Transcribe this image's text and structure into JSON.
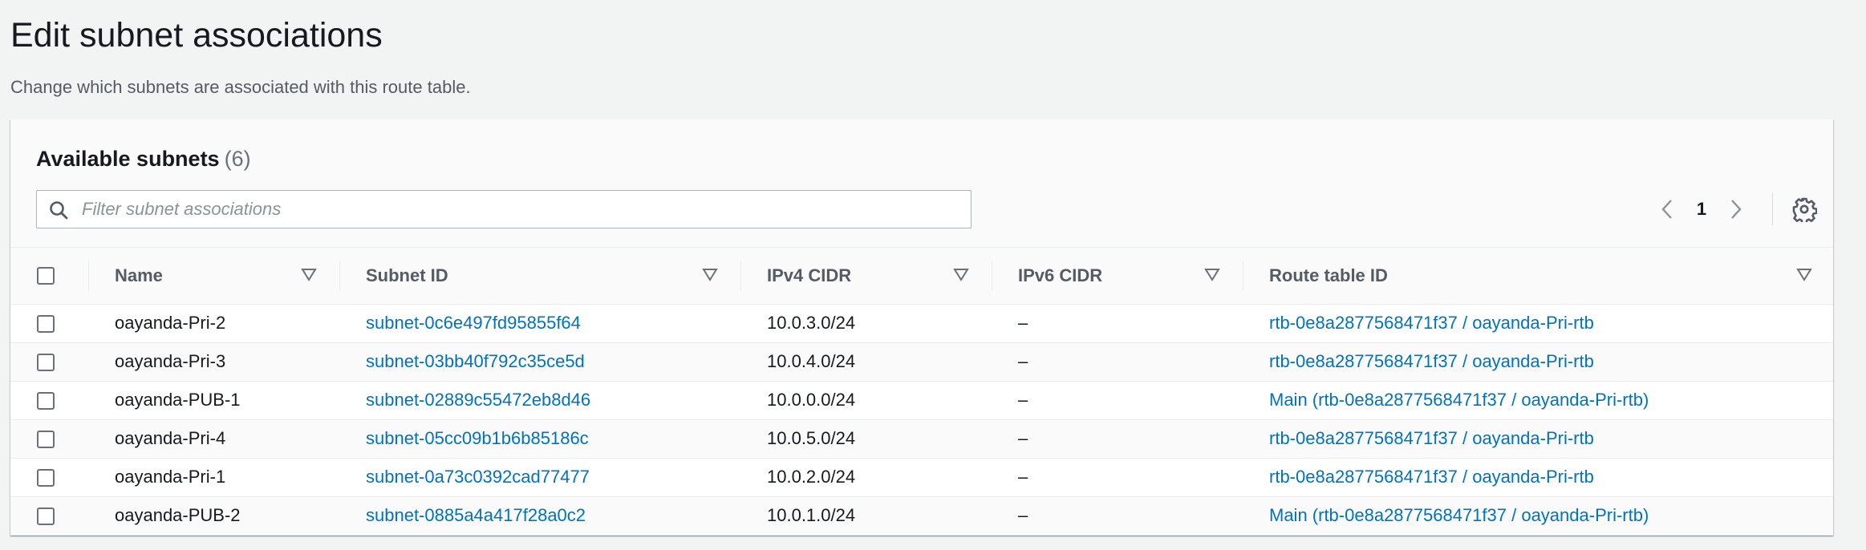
{
  "page": {
    "title": "Edit subnet associations",
    "description": "Change which subnets are associated with this route table."
  },
  "panel": {
    "title": "Available subnets",
    "count": "(6)"
  },
  "filter": {
    "placeholder": "Filter subnet associations",
    "value": ""
  },
  "pagination": {
    "current_page": "1"
  },
  "icons": {
    "search": "search-icon",
    "prev": "chevron-left-icon",
    "next": "chevron-right-icon",
    "settings": "gear-icon",
    "sort": "sort-triangle-icon"
  },
  "colors": {
    "link": "#0073bb",
    "header_text": "#545b64",
    "background": "#f2f3f3"
  },
  "table": {
    "columns": [
      "Name",
      "Subnet ID",
      "IPv4 CIDR",
      "IPv6 CIDR",
      "Route table ID"
    ],
    "rows": [
      {
        "name": "oayanda-Pri-2",
        "subnet_id": "subnet-0c6e497fd95855f64",
        "ipv4": "10.0.3.0/24",
        "ipv6": "–",
        "route_table": "rtb-0e8a2877568471f37 / oayanda-Pri-rtb"
      },
      {
        "name": "oayanda-Pri-3",
        "subnet_id": "subnet-03bb40f792c35ce5d",
        "ipv4": "10.0.4.0/24",
        "ipv6": "–",
        "route_table": "rtb-0e8a2877568471f37 / oayanda-Pri-rtb"
      },
      {
        "name": "oayanda-PUB-1",
        "subnet_id": "subnet-02889c55472eb8d46",
        "ipv4": "10.0.0.0/24",
        "ipv6": "–",
        "route_table": "Main (rtb-0e8a2877568471f37 / oayanda-Pri-rtb)"
      },
      {
        "name": "oayanda-Pri-4",
        "subnet_id": "subnet-05cc09b1b6b85186c",
        "ipv4": "10.0.5.0/24",
        "ipv6": "–",
        "route_table": "rtb-0e8a2877568471f37 / oayanda-Pri-rtb"
      },
      {
        "name": "oayanda-Pri-1",
        "subnet_id": "subnet-0a73c0392cad77477",
        "ipv4": "10.0.2.0/24",
        "ipv6": "–",
        "route_table": "rtb-0e8a2877568471f37 / oayanda-Pri-rtb"
      },
      {
        "name": "oayanda-PUB-2",
        "subnet_id": "subnet-0885a4a417f28a0c2",
        "ipv4": "10.0.1.0/24",
        "ipv6": "–",
        "route_table": "Main (rtb-0e8a2877568471f37 / oayanda-Pri-rtb)"
      }
    ]
  }
}
